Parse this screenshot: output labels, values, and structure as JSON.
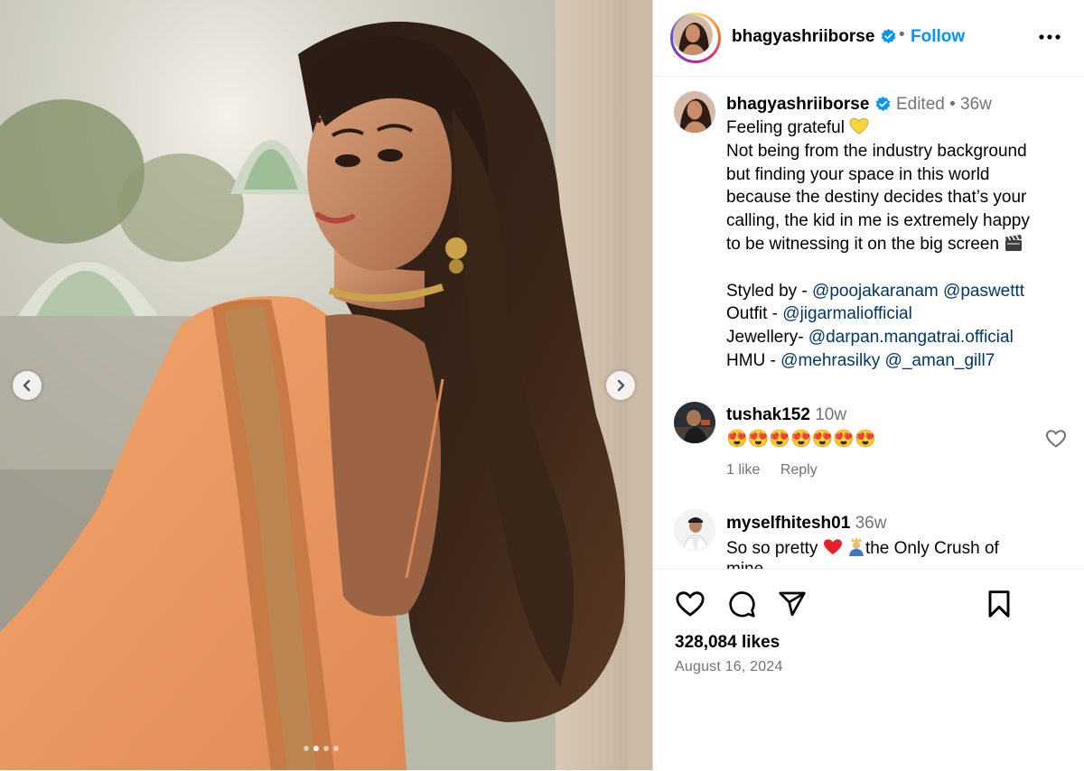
{
  "post": {
    "username": "bhagyashriiborse",
    "follow_label": "Follow",
    "separator": "•",
    "caption": {
      "edited_label": "Edited",
      "time": "36w",
      "line1": "Feeling grateful",
      "line2": "Not being from the industry background",
      "line3": "but finding your space in this world",
      "line4": "because the destiny decides that’s your",
      "line5": "calling, the kid in me is extremely happy",
      "line6": "to be witnessing it on the big screen",
      "styled_prefix": "Styled by - ",
      "styled_mention1": "@poojakaranam",
      "styled_mention2": "@paswettt",
      "outfit_prefix": "Outfit - ",
      "outfit_mention": "@jigarmaliofficial",
      "jewellery_prefix": "Jewellery- ",
      "jewellery_mention": "@darpan.mangatrai.official",
      "hmu_prefix": "HMU - ",
      "hmu_mention1": "@mehrasilky",
      "hmu_mention2": "@_aman_gill7"
    },
    "likes": "328,084 likes",
    "date": "August 16, 2024"
  },
  "comments": [
    {
      "username": "tushak152",
      "time": "10w",
      "text": "😍😍😍😍😍😍😍",
      "likes_label": "1 like",
      "reply_label": "Reply"
    },
    {
      "username": "myselfhitesh01",
      "time": "36w",
      "text_before": "So so pretty",
      "text_after": "the Only Crush of",
      "text_cut": "mine"
    }
  ],
  "carousel": {
    "slide_count": 4,
    "active_index": 1
  },
  "icons": {
    "verified": "verified-badge-icon",
    "more": "more-options-icon",
    "like": "heart-icon",
    "comment": "comment-icon",
    "share": "share-icon",
    "save": "bookmark-icon",
    "prev": "chevron-left-icon",
    "next": "chevron-right-icon"
  },
  "colors": {
    "link": "#00376b",
    "follow": "#0095f6",
    "verified": "#0095f6",
    "secondary_text": "#737373"
  }
}
